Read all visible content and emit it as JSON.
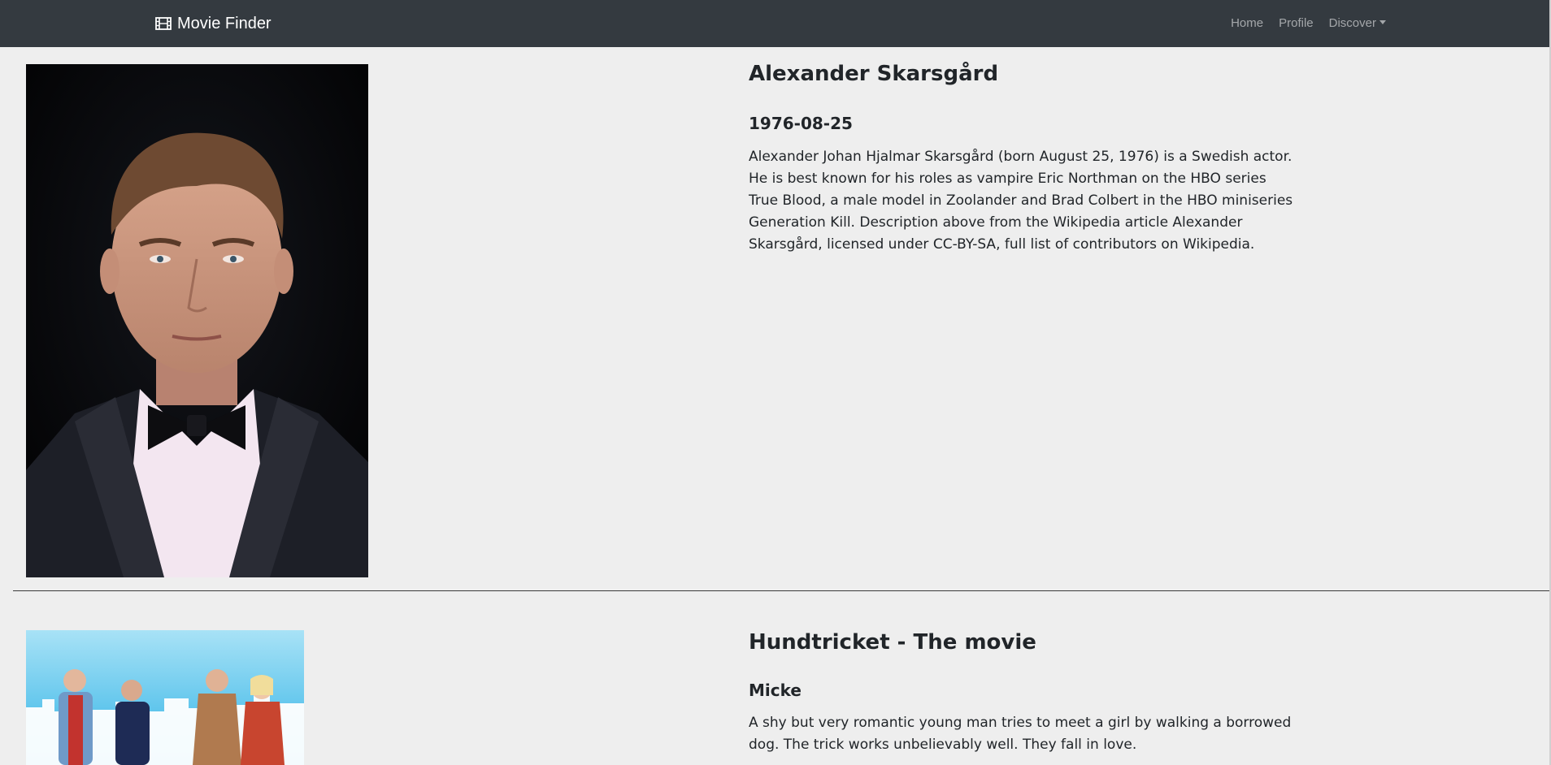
{
  "navbar": {
    "brand_icon": "film-icon",
    "brand_text": "Movie Finder",
    "links": {
      "home": "Home",
      "profile": "Profile",
      "discover": "Discover"
    }
  },
  "person": {
    "name": "Alexander Skarsgård",
    "birthday": "1976-08-25",
    "bio": "Alexander Johan Hjalmar Skarsgård (born August 25, 1976) is a Swedish actor. He is best known for his roles as vampire Eric Northman on the HBO series True Blood, a male model in Zoolander and Brad Colbert in the HBO miniseries Generation Kill. Description above from the Wikipedia article Alexander Skarsgård, licensed under CC-BY-SA, full list of contributors on Wikipedia."
  },
  "credits": [
    {
      "title": "Hundtricket - The movie",
      "character": "Micke",
      "overview": "A shy but very romantic young man tries to meet a girl by walking a borrowed dog. The trick works unbelievably well. They fall in love."
    }
  ],
  "colors": {
    "navbar": "#343a40",
    "page_background": "#eeeeee",
    "text": "#212529"
  }
}
